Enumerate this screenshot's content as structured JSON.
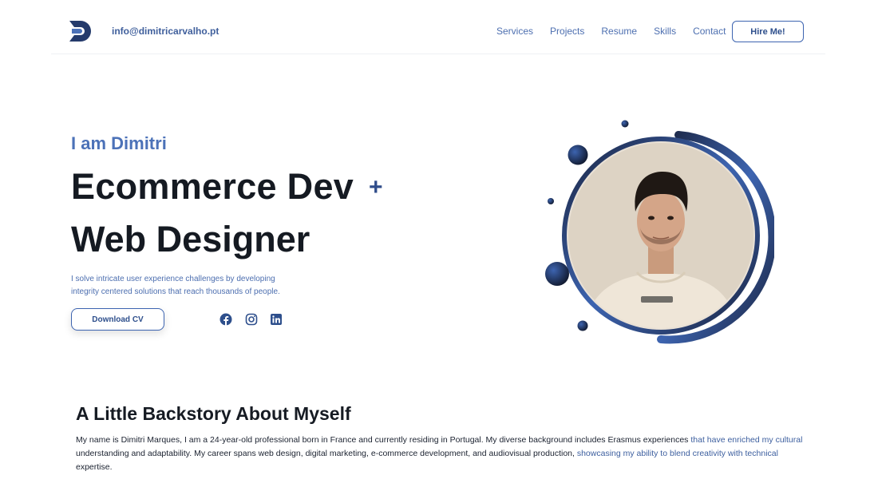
{
  "header": {
    "email": "info@dimitricarvalho.pt",
    "nav": [
      "Services",
      "Projects",
      "Resume",
      "Skills",
      "Contact"
    ],
    "hire_label": "Hire Me!"
  },
  "hero": {
    "greeting": "I am Dimitri",
    "title_line1_main": "Ecommerce Dev",
    "title_plus": "+",
    "title_line2": "Web Designer",
    "description": "I solve intricate user experience challenges by developing integrity centered solutions that reach thousands of people.",
    "download_label": "Download CV",
    "social": [
      "facebook-icon",
      "instagram-icon",
      "linkedin-icon"
    ]
  },
  "backstory": {
    "title": "A Little Backstory About Myself",
    "text_part1": "My name is Dimitri Marques, I am a 24-year-old professional born in France and currently residing in Portugal. My diverse background includes Erasmus experiences ",
    "text_part2": "that have enriched my cultural",
    "text_part3": " understanding and adaptability. My career spans web design, digital marketing, e-commerce development, and audiovisual production, ",
    "text_part4": "showcasing my ability to blend creativity with technical",
    "text_part5": " expertise."
  },
  "colors": {
    "accent": "#3d64b0",
    "dark_navy": "#1f2f55",
    "text_dark": "#151a22"
  }
}
